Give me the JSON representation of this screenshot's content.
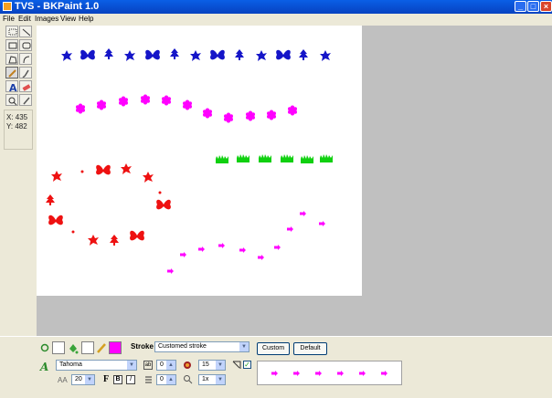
{
  "window": {
    "title": "TVS - BKPaint 1.0"
  },
  "menu": [
    "File",
    "Edit",
    "Images",
    "View",
    "Help"
  ],
  "toolbox": {
    "tools": [
      "rect-select",
      "line",
      "rectangle",
      "rounded-rect",
      "polygon",
      "curve",
      "pencil",
      "brush",
      "text",
      "eraser",
      "zoom",
      "color-picker"
    ],
    "active": "pencil"
  },
  "coords": {
    "x_label": "X: 435",
    "y_label": "Y: 482"
  },
  "stroke": {
    "label": "Stroke",
    "value": "Customed stroke",
    "custom_label": "Custom",
    "default_label": "Default"
  },
  "font": {
    "family": "Tahoma",
    "size": "20",
    "bold": "B",
    "italic": "I",
    "spacing": "0",
    "line_spacing": "0"
  },
  "brush": {
    "size": "15",
    "zoom": "1x"
  },
  "colors": {
    "primary": "#ff00ff",
    "secondary": "#ffffff",
    "blue": "#1515c8",
    "magenta": "#ff00ff",
    "green": "#10d010",
    "red": "#ee1111"
  }
}
